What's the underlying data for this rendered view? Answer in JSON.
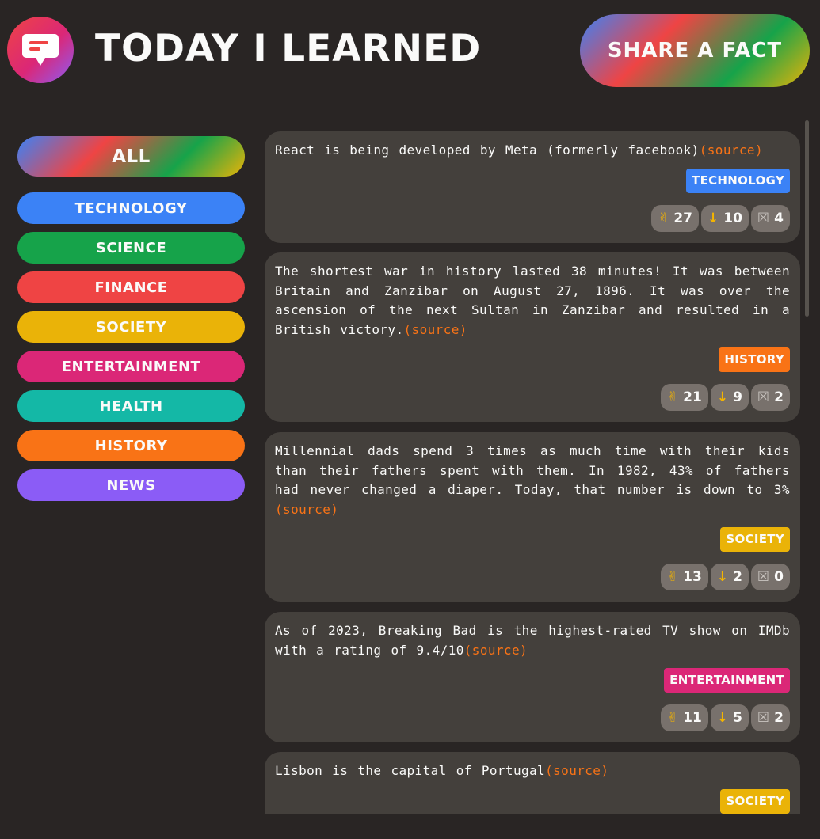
{
  "header": {
    "title": "TODAY I LEARNED",
    "share_label": "SHARE A FACT"
  },
  "sidebar": {
    "all_label": "ALL",
    "categories": [
      {
        "label": "TECHNOLOGY",
        "color": "#3b82f6"
      },
      {
        "label": "SCIENCE",
        "color": "#16a34a"
      },
      {
        "label": "FINANCE",
        "color": "#ef4444"
      },
      {
        "label": "SOCIETY",
        "color": "#eab308"
      },
      {
        "label": "ENTERTAINMENT",
        "color": "#db2777"
      },
      {
        "label": "HEALTH",
        "color": "#14b8a6"
      },
      {
        "label": "HISTORY",
        "color": "#f97316"
      },
      {
        "label": "NEWS",
        "color": "#8b5cf6"
      }
    ]
  },
  "facts": [
    {
      "text": "React is being developed by Meta (formerly facebook)",
      "source": "(source)",
      "category": "TECHNOLOGY",
      "color": "#3b82f6",
      "interesting": "27",
      "false_votes": "10",
      "trash": "4"
    },
    {
      "text": "The shortest war in history lasted 38 minutes! It was between Britain and Zanzibar on August 27, 1896. It was over the ascension of the next Sultan in Zanzibar and resulted in a British victory.",
      "source": "(source)",
      "category": "HISTORY",
      "color": "#f97316",
      "interesting": "21",
      "false_votes": "9",
      "trash": "2"
    },
    {
      "text": "Millennial dads spend 3 times as much time with their kids than their fathers spent with them. In 1982, 43% of fathers had never changed a diaper. Today, that number is down to 3%",
      "source": "(source)",
      "category": "SOCIETY",
      "color": "#eab308",
      "interesting": "13",
      "false_votes": "2",
      "trash": "0"
    },
    {
      "text": "As of 2023, Breaking Bad is the highest-rated TV show on IMDb with a rating of 9.4/10",
      "source": "(source)",
      "category": "ENTERTAINMENT",
      "color": "#db2777",
      "interesting": "11",
      "false_votes": "5",
      "trash": "2"
    },
    {
      "text": "Lisbon is the capital of Portugal",
      "source": "(source)",
      "category": "SOCIETY",
      "color": "#eab308",
      "interesting": "",
      "false_votes": "",
      "trash": ""
    }
  ]
}
